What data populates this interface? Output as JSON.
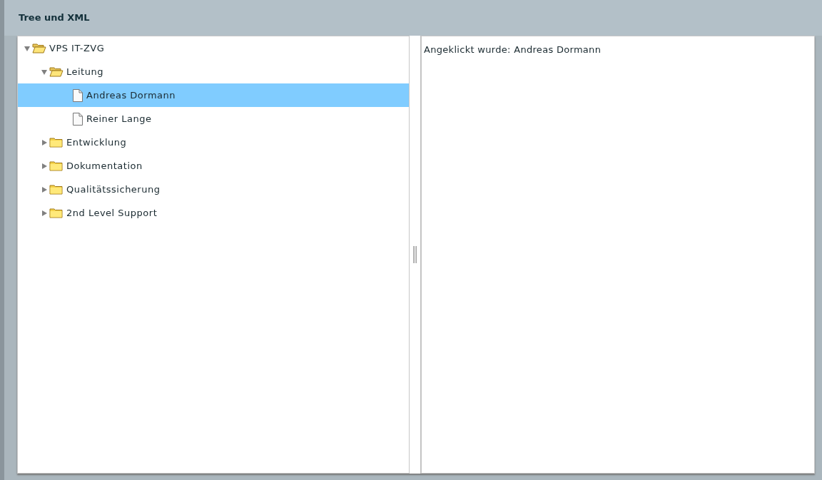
{
  "panel": {
    "title": "Tree und XML"
  },
  "tree": [
    {
      "label": "VPS IT-ZVG",
      "kind": "folder",
      "expanded": true,
      "selected": false,
      "children": [
        {
          "label": "Leitung",
          "kind": "folder",
          "expanded": true,
          "selected": false,
          "children": [
            {
              "label": "Andreas Dormann",
              "kind": "leaf",
              "selected": true
            },
            {
              "label": "Reiner Lange",
              "kind": "leaf",
              "selected": false
            }
          ]
        },
        {
          "label": "Entwicklung",
          "kind": "folder",
          "expanded": false,
          "selected": false
        },
        {
          "label": "Dokumentation",
          "kind": "folder",
          "expanded": false,
          "selected": false
        },
        {
          "label": "Qualitätssicherung",
          "kind": "folder",
          "expanded": false,
          "selected": false
        },
        {
          "label": "2nd Level Support",
          "kind": "folder",
          "expanded": false,
          "selected": false
        }
      ]
    }
  ],
  "detail": {
    "text": "Angeklickt wurde: Andreas Dormann"
  }
}
